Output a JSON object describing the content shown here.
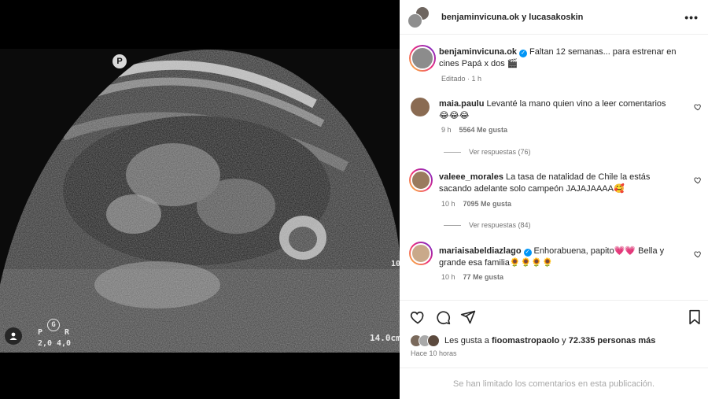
{
  "media": {
    "ultrasound": {
      "badge_p": "P",
      "badge_g": "G",
      "label_p": "P",
      "label_r": "R",
      "value_left": "2,0",
      "value_right": "4,0",
      "depth": "14.0cm",
      "depth_side": "10"
    }
  },
  "header": {
    "title": "benjaminvicuna.ok y lucasakoskin",
    "more_label": "•••"
  },
  "caption": {
    "username": "benjaminvicuna.ok",
    "verified": true,
    "text": "Faltan 12 semanas... para estrenar en cines Papá x dos 🎬",
    "meta": "Editado · 1 h"
  },
  "comments": [
    {
      "username": "maia.paulu",
      "verified": false,
      "text": "Levanté la mano quien vino a leer comentarios 😂😂😂",
      "time": "9 h",
      "likes": "5564 Me gusta",
      "replies": "Ver respuestas (76)",
      "avatar_color": "#8a6b52"
    },
    {
      "username": "valeee_morales",
      "verified": false,
      "text": "La tasa de natalidad de Chile la estás sacando adelante solo campeón JAJAJAAAA🥰",
      "time": "10 h",
      "likes": "7095 Me gusta",
      "replies": "Ver respuestas (84)",
      "avatar_color": "#9a7a5e"
    },
    {
      "username": "mariaisabeldiazlago",
      "verified": true,
      "text": "Enhorabuena, papito💗💗 Bella y grande esa familia🌻🌻🌻🌻",
      "time": "10 h",
      "likes": "77 Me gusta",
      "avatar_color": "#c9a98a"
    }
  ],
  "likes": {
    "prefix": "Les gusta a",
    "user": "fioomastropaolo",
    "connector": "y",
    "count": "72.335 personas más"
  },
  "posted": "Hace 10 horas",
  "footer": "Se han limitado los comentarios en esta publicación.",
  "icons": [
    "heart-icon",
    "comment-icon",
    "share-icon",
    "bookmark-icon",
    "more-icon",
    "verified-icon",
    "user-tag-icon"
  ]
}
